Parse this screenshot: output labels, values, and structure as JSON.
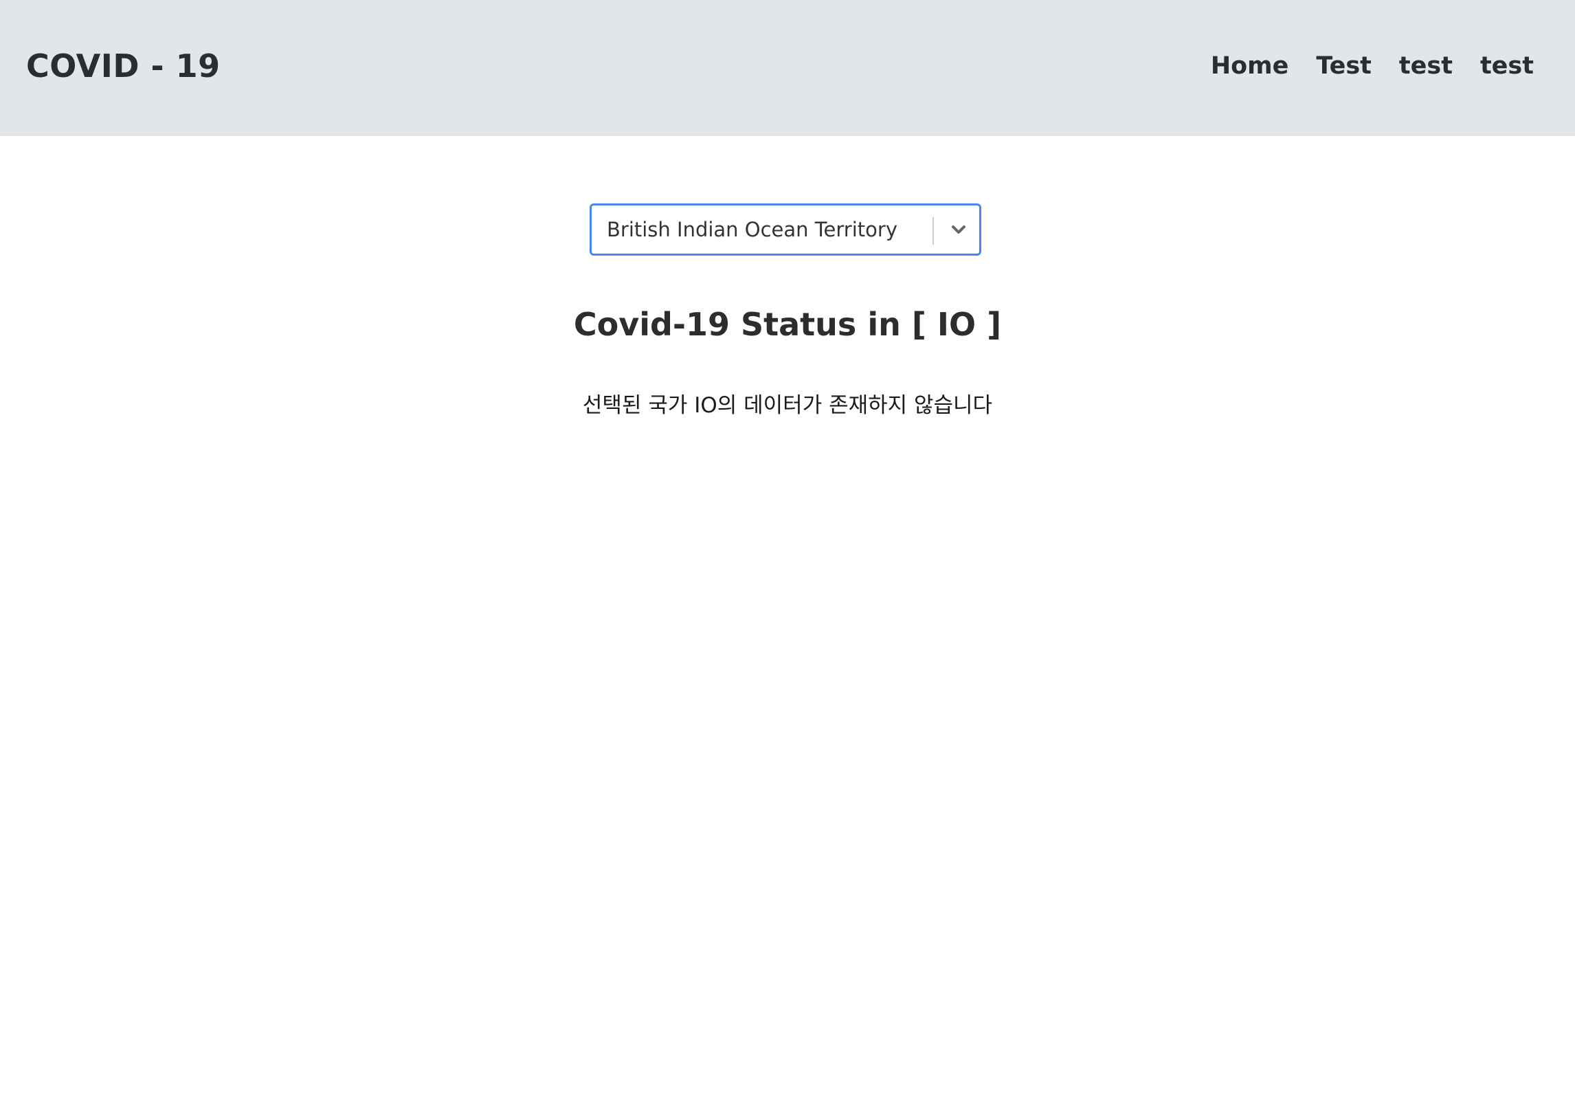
{
  "header": {
    "brand": "COVID - 19",
    "nav": [
      "Home",
      "Test",
      "test",
      "test"
    ]
  },
  "country_select": {
    "selected": "British Indian Ocean Territory",
    "icon": "chevron-down-icon",
    "accent_color": "#4a86e6"
  },
  "main": {
    "title": "Covid-19 Status in [ IO ]",
    "message": "선택된 국가 IO의 데이터가 존재하지 않습니다"
  },
  "colors": {
    "navbar_bg": "#e2e5e9",
    "text": "#2c2d30"
  }
}
